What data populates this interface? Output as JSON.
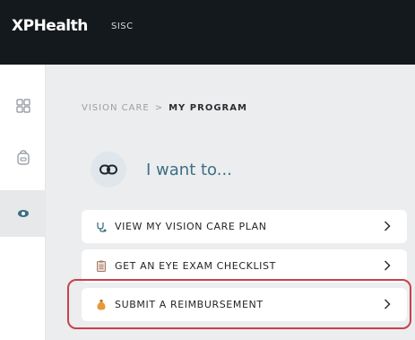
{
  "header": {
    "logo_text": "XPHealth",
    "org_name": "SISC"
  },
  "sidebar": {
    "items": [
      {
        "icon": "dashboard-grid-icon",
        "active": false
      },
      {
        "icon": "wallet-bag-icon",
        "active": false
      },
      {
        "icon": "eye-icon",
        "active": true
      }
    ]
  },
  "breadcrumb": {
    "parent": "VISION CARE",
    "separator": ">",
    "current": "MY PROGRAM"
  },
  "iwant": {
    "icon": "link-icon",
    "text": "I want to..."
  },
  "actions": [
    {
      "icon": "stethoscope-icon",
      "label": "VIEW MY VISION CARE PLAN",
      "icon_color": "#3c6f84"
    },
    {
      "icon": "clipboard-icon",
      "label": "GET AN EYE EXAM CHECKLIST",
      "icon_color": "#a67c6a"
    },
    {
      "icon": "money-bag-icon",
      "label": "SUBMIT A REIMBURSEMENT",
      "icon_color": "#d98a2b"
    }
  ],
  "colors": {
    "header_bg": "#14191d",
    "accent": "#3c6f84",
    "highlight": "#c8424a",
    "main_bg": "#ecedee"
  }
}
